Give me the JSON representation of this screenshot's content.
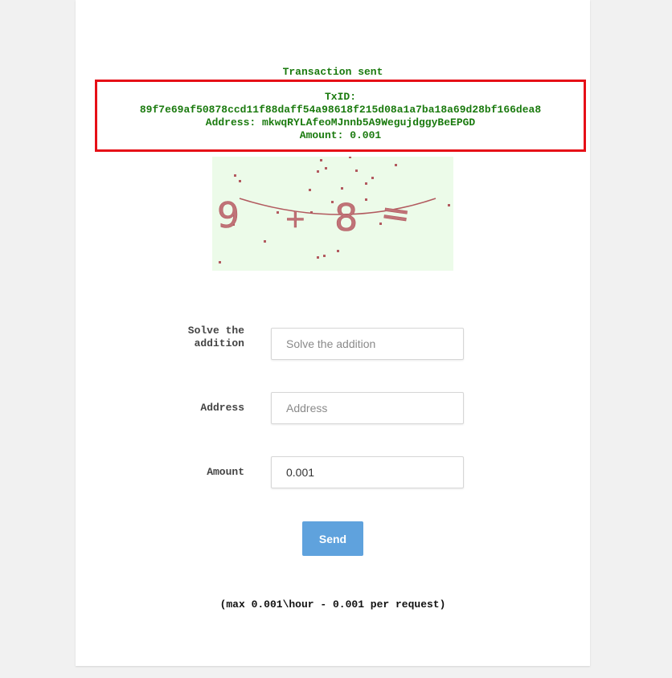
{
  "status": {
    "title": "Transaction sent",
    "txid_label": "TxID:",
    "txid": "89f7e69af50878ccd11f88daff54a98618f215d08a1a7ba18a69d28bf166dea8",
    "address_line": "Address: mkwqRYLAfeoMJnnb5A9WegujdggyBeEPGD",
    "amount_line": "Amount: 0.001"
  },
  "captcha": {
    "glyphs": [
      "9",
      "+",
      "8",
      "="
    ]
  },
  "form": {
    "solve_label": "Solve the addition",
    "solve_placeholder": "Solve the addition",
    "address_label": "Address",
    "address_placeholder": "Address",
    "amount_label": "Amount",
    "amount_value": "0.001",
    "send_label": "Send"
  },
  "footer": {
    "limits": "(max 0.001\\hour - 0.001 per request)"
  },
  "colors": {
    "success_text": "#1a7a0e",
    "highlight_border": "#e60f17",
    "button_bg": "#5fa2dd",
    "captcha_bg": "#ecfbe9",
    "captcha_ink": "#b25a5f"
  }
}
